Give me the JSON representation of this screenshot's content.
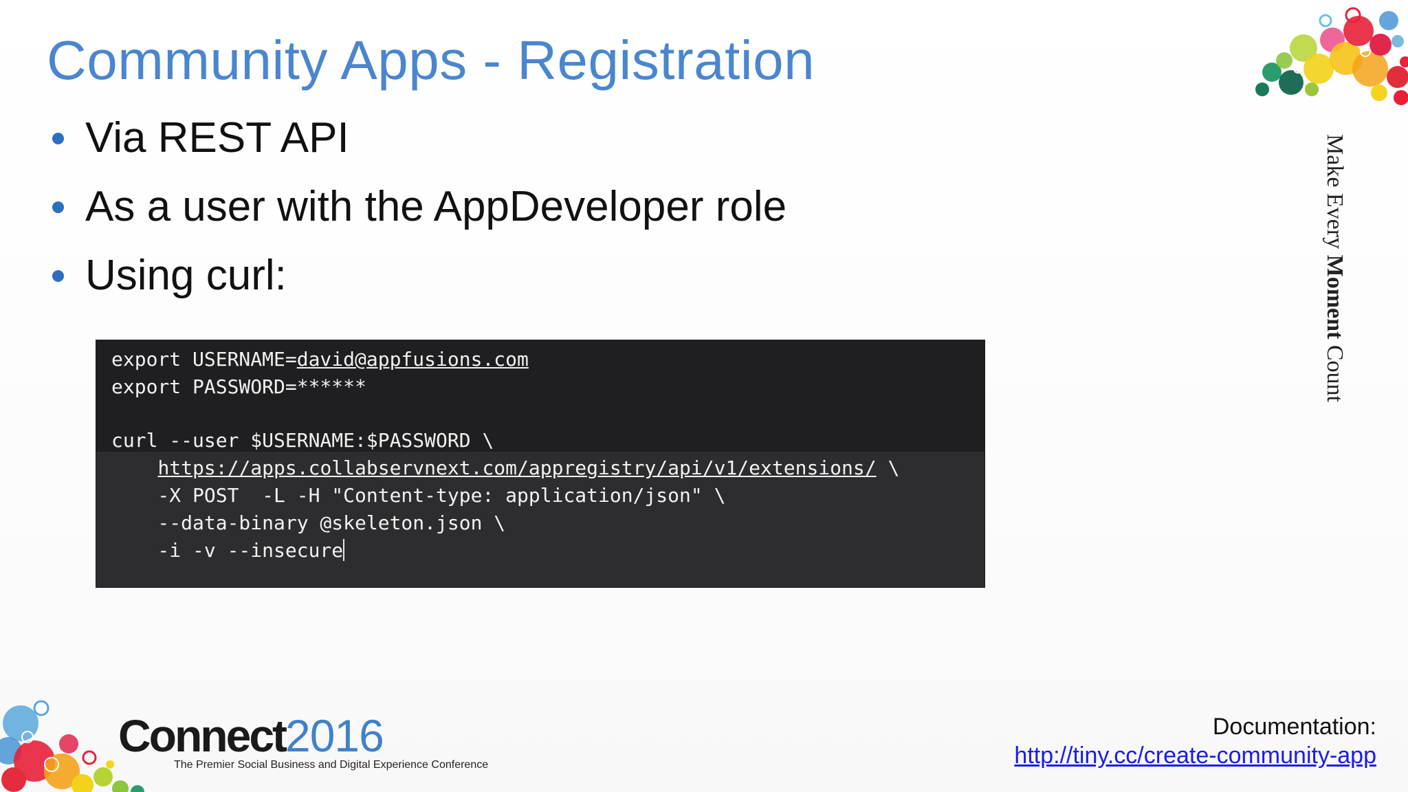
{
  "slide": {
    "title": "Community Apps - Registration",
    "bullets": [
      "Via REST API",
      "As a user with the AppDeveloper role",
      "Using curl:"
    ]
  },
  "code": {
    "lines": [
      {
        "prefix": "export USERNAME=",
        "link": "david@appfusions.com",
        "suffix": ""
      },
      {
        "prefix": "export PASSWORD=******",
        "link": "",
        "suffix": ""
      },
      {
        "prefix": "curl --user $USERNAME:$PASSWORD \\",
        "link": "",
        "suffix": ""
      },
      {
        "prefix": "    ",
        "link": "https://apps.collabservnext.com/appregistry/api/v1/extensions/",
        "suffix": " \\"
      },
      {
        "prefix": "    -X POST  -L -H \"Content-type: application/json\" \\",
        "link": "",
        "suffix": ""
      },
      {
        "prefix": "    --data-binary @skeleton.json \\",
        "link": "",
        "suffix": ""
      },
      {
        "prefix": "    -i -v --insecure",
        "link": "",
        "suffix": ""
      }
    ]
  },
  "tagline": {
    "part1": "Make Every ",
    "bold": "Moment",
    "part2": " Count"
  },
  "brand": {
    "name": "Connect",
    "year": "2016",
    "subtitle": "The Premier Social Business and Digital Experience Conference"
  },
  "documentation": {
    "label": "Documentation:",
    "link": "http://tiny.cc/create-community-app"
  },
  "colors": {
    "title": "#4a86cf",
    "bullet": "#2c6fbf",
    "code_background": "#2d2d2f",
    "link": "#1a1aee"
  }
}
